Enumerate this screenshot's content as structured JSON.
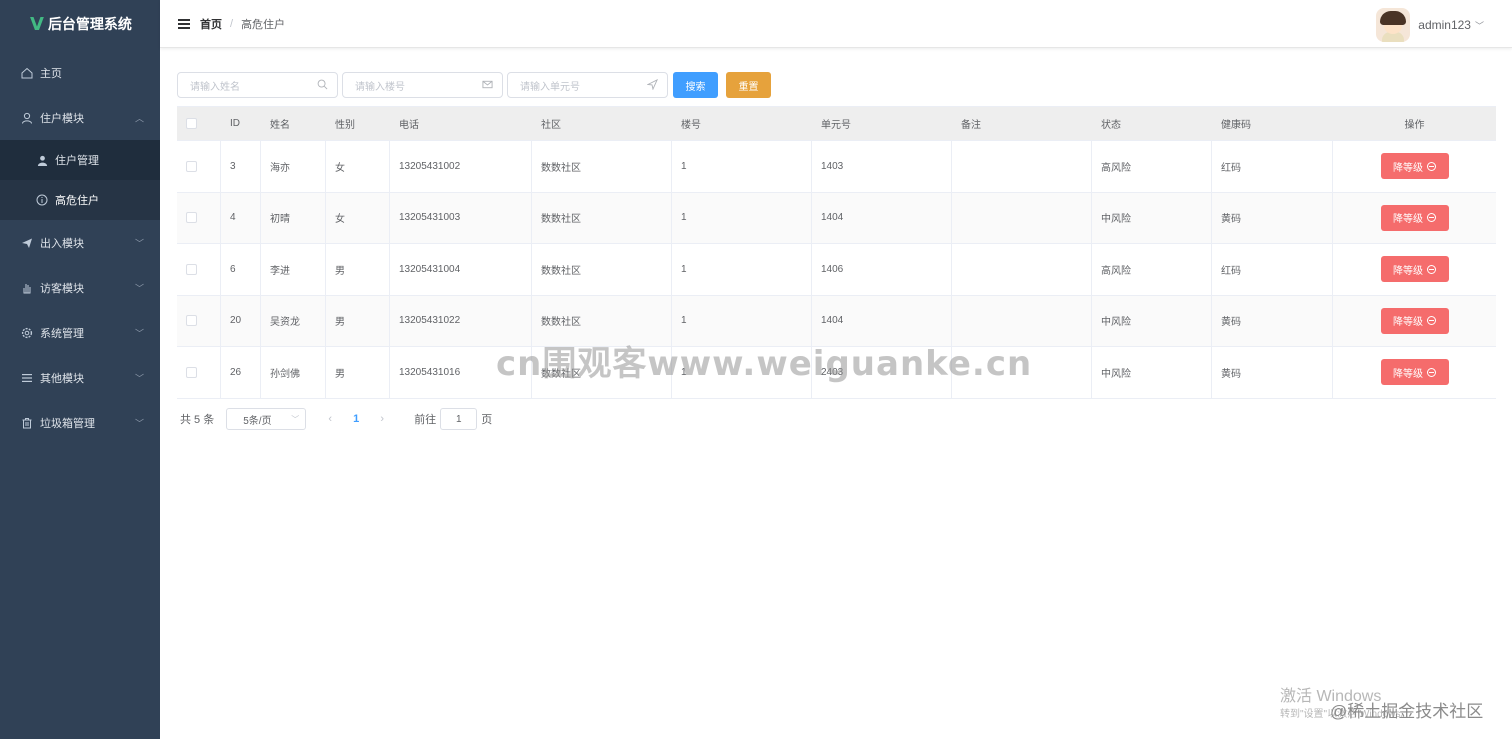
{
  "app": {
    "title": "后台管理系统"
  },
  "sidebar": {
    "items": [
      {
        "label": "主页",
        "icon": "home-icon"
      },
      {
        "label": "住户模块",
        "icon": "user-icon",
        "expanded": true,
        "children": [
          {
            "label": "住户管理",
            "icon": "user-fill-icon"
          },
          {
            "label": "高危住户",
            "icon": "info-icon",
            "active": true
          }
        ]
      },
      {
        "label": "出入模块",
        "icon": "send-icon"
      },
      {
        "label": "访客模块",
        "icon": "hand-icon"
      },
      {
        "label": "系统管理",
        "icon": "gear-icon"
      },
      {
        "label": "其他模块",
        "icon": "list-icon"
      },
      {
        "label": "垃圾箱管理",
        "icon": "trash-icon"
      }
    ]
  },
  "header": {
    "breadcrumb_home": "首页",
    "breadcrumb_sep": "/",
    "breadcrumb_current": "高危住户",
    "username": "admin123"
  },
  "search": {
    "name_placeholder": "请输入姓名",
    "building_placeholder": "请输入楼号",
    "unit_placeholder": "请输入单元号",
    "search_label": "搜索",
    "reset_label": "重置"
  },
  "table": {
    "headers": [
      "ID",
      "姓名",
      "性别",
      "电话",
      "社区",
      "楼号",
      "单元号",
      "备注",
      "状态",
      "健康码",
      "操作"
    ],
    "rows": [
      {
        "id": "3",
        "name": "海亦",
        "gender": "女",
        "phone": "13205431002",
        "community": "数数社区",
        "building": "1",
        "unit": "1403",
        "remark": "",
        "status": "高风险",
        "health": "红码"
      },
      {
        "id": "4",
        "name": "初晴",
        "gender": "女",
        "phone": "13205431003",
        "community": "数数社区",
        "building": "1",
        "unit": "1404",
        "remark": "",
        "status": "中风险",
        "health": "黄码"
      },
      {
        "id": "6",
        "name": "李进",
        "gender": "男",
        "phone": "13205431004",
        "community": "数数社区",
        "building": "1",
        "unit": "1406",
        "remark": "",
        "status": "高风险",
        "health": "红码"
      },
      {
        "id": "20",
        "name": "吴资龙",
        "gender": "男",
        "phone": "13205431022",
        "community": "数数社区",
        "building": "1",
        "unit": "1404",
        "remark": "",
        "status": "中风险",
        "health": "黄码"
      },
      {
        "id": "26",
        "name": "孙剑佛",
        "gender": "男",
        "phone": "13205431016",
        "community": "数数社区",
        "building": "1",
        "unit": "2403",
        "remark": "",
        "status": "中风险",
        "health": "黄码"
      }
    ],
    "action_label": "降等级"
  },
  "pagination": {
    "total": "共 5 条",
    "page_size": "5条/页",
    "current_page": "1",
    "goto_label": "前往",
    "goto_value": "1",
    "page_suffix": "页"
  },
  "watermarks": {
    "center": "cn围观客www.weiguanke.cn",
    "windows_title": "激活 Windows",
    "windows_sub": "转到\"设置\"以激活 Windows。",
    "juejin": "@稀土掘金技术社区"
  },
  "colors": {
    "sidebar_bg": "#304156",
    "primary": "#409eff",
    "warning": "#e6a23c",
    "danger": "#f56c6c",
    "logo_accent": "#42b983"
  }
}
